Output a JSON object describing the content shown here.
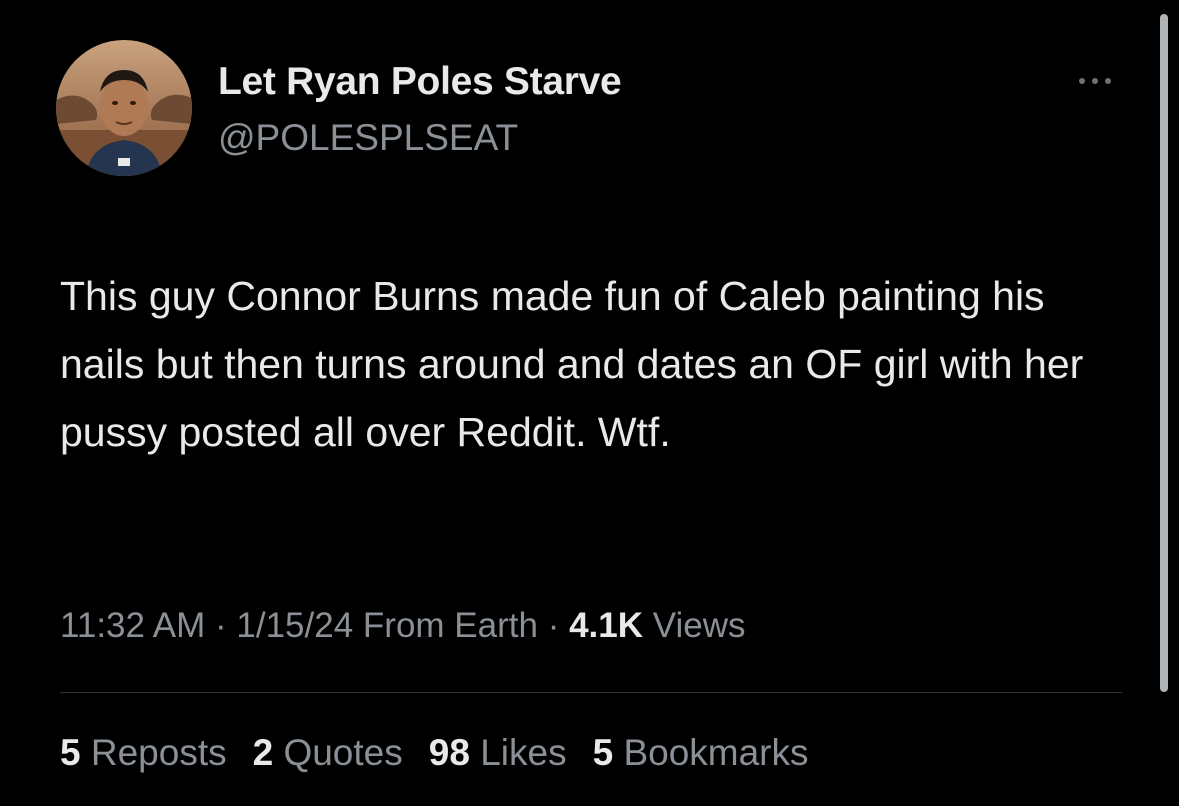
{
  "author": {
    "display_name": "Let Ryan Poles Starve",
    "handle": "@POLESPLSEAT"
  },
  "tweet": {
    "text": "This guy Connor Burns made fun of Caleb painting his nails but then turns around and dates an OF girl with her pussy posted all over Reddit. Wtf."
  },
  "meta": {
    "time": "11:32 AM",
    "separator": "·",
    "date": "1/15/24",
    "source": "From Earth",
    "views_count": "4.1K",
    "views_label": "Views"
  },
  "stats": {
    "reposts_count": "5",
    "reposts_label": "Reposts",
    "quotes_count": "2",
    "quotes_label": "Quotes",
    "likes_count": "98",
    "likes_label": "Likes",
    "bookmarks_count": "5",
    "bookmarks_label": "Bookmarks"
  },
  "icons": {
    "more": "more-horizontal-icon"
  },
  "colors": {
    "background": "#000000",
    "primary_text": "#e7e9ea",
    "secondary_text": "#8b9096",
    "divider": "#2f3336"
  }
}
